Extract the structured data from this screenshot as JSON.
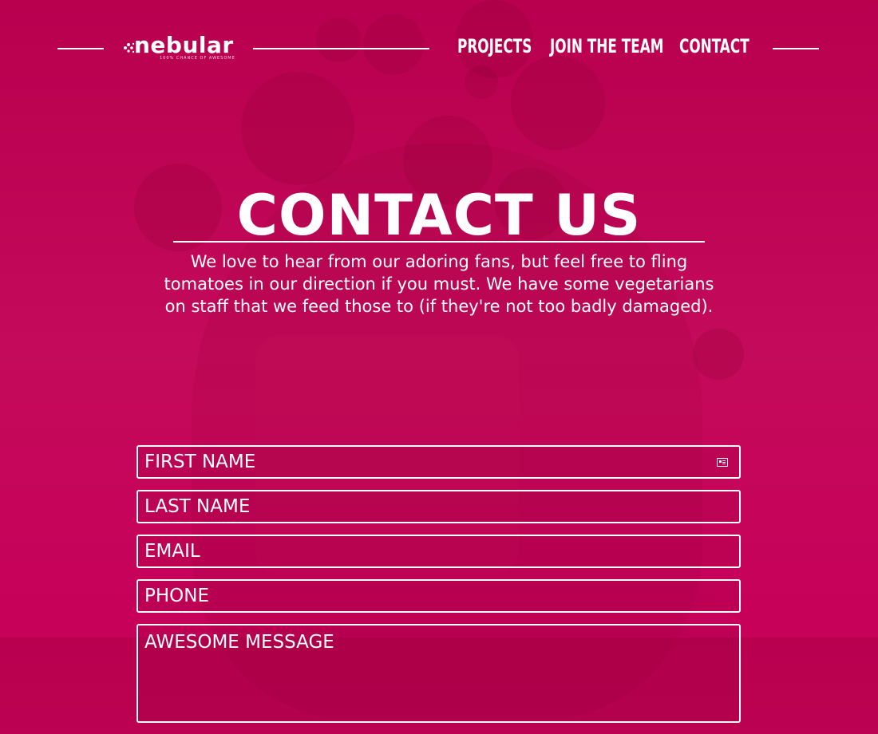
{
  "brand": {
    "name": "nebular",
    "tagline": "100% CHANCE OF AWESOME",
    "accent": "#c0005a"
  },
  "nav": {
    "items": [
      {
        "label": "PROJECTS"
      },
      {
        "label": "JOIN THE TEAM"
      },
      {
        "label": "CONTACT"
      }
    ]
  },
  "hero": {
    "title": "CONTACT US",
    "text": "We love to hear from our adoring fans, but feel free to fling tomatoes in our direction if you must. We have some vegetarians on staff that we feed those to (if they're not too badly damaged)."
  },
  "form": {
    "first_name_placeholder": "FIRST NAME",
    "last_name_placeholder": "LAST NAME",
    "email_placeholder": "EMAIL",
    "phone_placeholder": "PHONE",
    "message_placeholder": "AWESOME MESSAGE",
    "autofill_icon": "contact-card-icon"
  }
}
